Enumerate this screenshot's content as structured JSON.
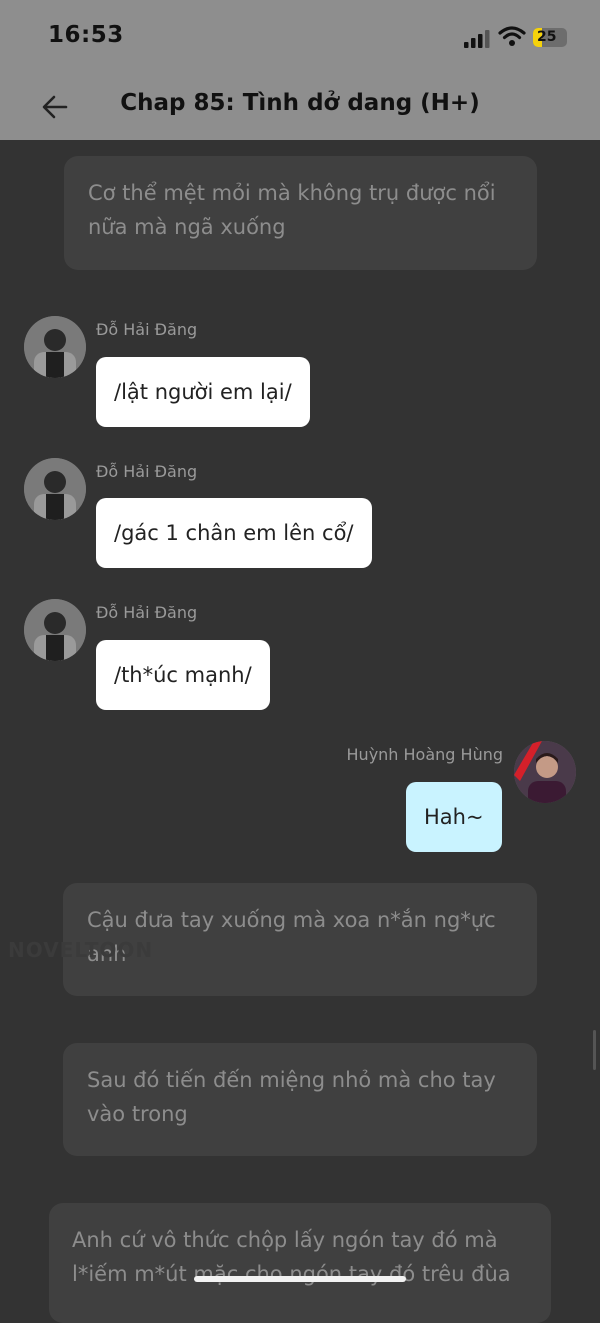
{
  "status_bar": {
    "time": "16:53",
    "battery": "25"
  },
  "header": {
    "title": "Chap 85: Tình dở dang (H+)"
  },
  "messages": [
    {
      "type": "narration",
      "text": "Cơ thể mệt mỏi mà không trụ được nổi nữa mà ngã xuống"
    },
    {
      "type": "left",
      "sender": "Đỗ Hải Đăng",
      "text": "/lật người em lại/"
    },
    {
      "type": "left",
      "sender": "Đỗ Hải Đăng",
      "text": "/gác 1 chân em lên cổ/"
    },
    {
      "type": "left",
      "sender": "Đỗ Hải Đăng",
      "text": "/th*úc mạnh/"
    },
    {
      "type": "right",
      "sender": "Huỳnh Hoàng Hùng",
      "text": "Hah~"
    },
    {
      "type": "narration",
      "text": "Cậu đưa tay xuống mà xoa n*ắn ng*ực anh"
    },
    {
      "type": "narration",
      "text": "Sau đó tiến đến miệng nhỏ mà cho tay vào trong"
    },
    {
      "type": "narration",
      "text": "Anh cứ vô thức chộp lấy ngón tay đó mà l*iếm m*út mặc cho ngón tay đó trêu đùa"
    }
  ],
  "watermark": "NOVELTOON",
  "colors": {
    "bubble_left": "#ffffff",
    "bubble_right": "#c9f3ff",
    "narration_bg": "#404040",
    "battery": "#f5d20b"
  }
}
